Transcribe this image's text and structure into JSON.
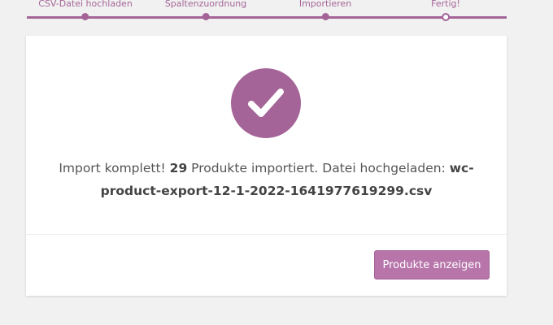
{
  "steps": [
    {
      "label": "CSV-Datei hochladen",
      "state": "done"
    },
    {
      "label": "Spaltenzuordnung",
      "state": "done"
    },
    {
      "label": "Importieren",
      "state": "done"
    },
    {
      "label": "Fertig!",
      "state": "current"
    }
  ],
  "result": {
    "icon": "checkmark-icon",
    "text_before": "Import komplett! ",
    "count": "29",
    "text_middle": " Produkte importiert. Datei hochgeladen: ",
    "filename": "wc-product-export-12-1-2022-1641977619299.csv"
  },
  "actions": {
    "view_products_label": "Produkte anzeigen"
  },
  "colors": {
    "accent": "#a46497",
    "button": "#b775aa",
    "background": "#f1f1f1"
  }
}
